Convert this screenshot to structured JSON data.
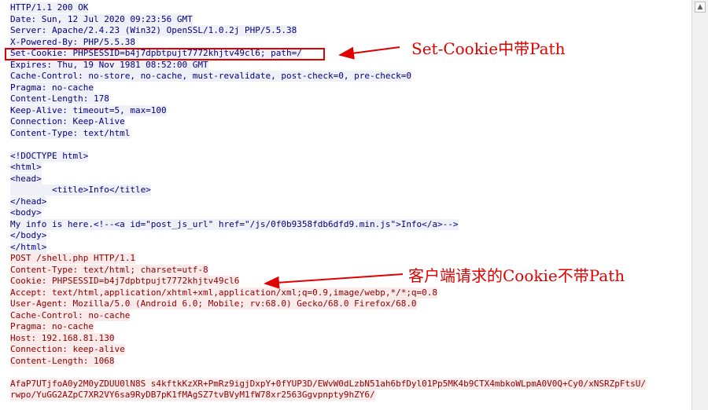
{
  "response_lines": [
    "HTTP/1.1 200 OK",
    "Date: Sun, 12 Jul 2020 09:23:56 GMT",
    "Server: Apache/2.4.23 (Win32) OpenSSL/1.0.2j PHP/5.5.38",
    "X-Powered-By: PHP/5.5.38",
    "Set-Cookie: PHPSESSID=b4j7dpbtpujt7772khjtv49cl6; path=/",
    "Expires: Thu, 19 Nov 1981 08:52:00 GMT",
    "Cache-Control: no-store, no-cache, must-revalidate, post-check=0, pre-check=0",
    "Pragma: no-cache",
    "Content-Length: 178",
    "Keep-Alive: timeout=5, max=100",
    "Connection: Keep-Alive",
    "Content-Type: text/html",
    "",
    "<!DOCTYPE html>",
    "<html>",
    "<head>",
    "        <title>Info</title>",
    "</head>",
    "<body>",
    "My info is here.<!--<a id=\"post_js_url\" href=\"/js/0f0b9358fdb6dfd9.min.js\">Info</a>-->",
    "</body>",
    "</html>"
  ],
  "request_lines": [
    "POST /shell.php HTTP/1.1",
    "Content-Type: text/html; charset=utf-8",
    "Cookie: PHPSESSID=b4j7dpbtpujt7772khjtv49cl6",
    "Accept: text/html,application/xhtml+xml,application/xml;q=0.9,image/webp,*/*;q=0.8",
    "User-Agent: Mozilla/5.0 (Android 6.0; Mobile; rv:68.0) Gecko/68.0 Firefox/68.0",
    "Cache-Control: no-cache",
    "Pragma: no-cache",
    "Host: 192.168.81.130",
    "Connection: keep-alive",
    "Content-Length: 1068",
    "",
    "AfaP7UTjfoA0y2M0yZDUU0lN8S s4kftkKzXR+PmRz9igjDxpY+0fYUP3D/EWvW0dLzbN51ah6bfDyl01Pp5MK4b9CTX4mbkoWLpmA0V0Q+Cy0/xNSRZpFtsU/",
    "rwpo/YuGG2AZpC7XR2VY6sa9RyDB7pK1fMAgSZ7tvBVyM1fW78xr2563Ggvpnpty9hZY6/"
  ],
  "annotations": {
    "set_cookie": "Set-Cookie中带Path",
    "cookie": "客户端请求的Cookie不带Path"
  },
  "colors": {
    "response_text": "#000080",
    "request_text": "#8b0000",
    "annotation": "#e00000"
  },
  "scrollbar": {
    "up_icon": "▲"
  }
}
